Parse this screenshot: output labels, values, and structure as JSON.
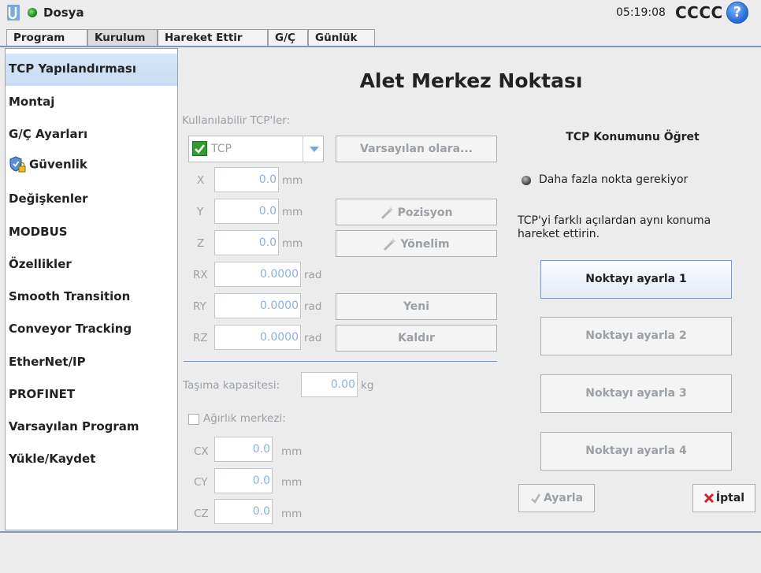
{
  "topbar": {
    "file_label": "Dosya",
    "clock": "05:19:08",
    "robot_name": "CCCC",
    "help_symbol": "?"
  },
  "tabs": [
    {
      "label": "Program",
      "active": false
    },
    {
      "label": "Kurulum",
      "active": true
    },
    {
      "label": "Hareket Ettir",
      "active": false
    },
    {
      "label": "G/Ç",
      "active": false
    },
    {
      "label": "Günlük",
      "active": false
    }
  ],
  "sidebar": {
    "items": [
      {
        "label": "TCP Yapılandırması",
        "active": true
      },
      {
        "label": "Montaj"
      },
      {
        "label": "G/Ç Ayarları"
      },
      {
        "label": "Güvenlik",
        "icon": "shield-lock-icon"
      },
      {
        "label": "Değişkenler"
      },
      {
        "label": "MODBUS"
      },
      {
        "label": "Özellikler"
      },
      {
        "label": "Smooth Transition"
      },
      {
        "label": "Conveyor Tracking"
      },
      {
        "label": "EtherNet/IP"
      },
      {
        "label": "PROFINET"
      },
      {
        "label": "Varsayılan Program"
      },
      {
        "label": "Yükle/Kaydet"
      }
    ]
  },
  "main": {
    "title": "Alet Merkez Noktası",
    "available_label": "Kullanılabilir TCP'ler:",
    "tcp_select": {
      "value": "TCP",
      "checked": true
    },
    "default_button": "Varsayılan olara...",
    "coords": [
      {
        "label": "X",
        "value": "0.0",
        "unit": "mm"
      },
      {
        "label": "Y",
        "value": "0.0",
        "unit": "mm"
      },
      {
        "label": "Z",
        "value": "0.0",
        "unit": "mm"
      },
      {
        "label": "RX",
        "value": "0.0000",
        "unit": "rad"
      },
      {
        "label": "RY",
        "value": "0.0000",
        "unit": "rad"
      },
      {
        "label": "RZ",
        "value": "0.0000",
        "unit": "rad"
      }
    ],
    "position_button": "Pozisyon",
    "orientation_button": "Yönelim",
    "new_button": "Yeni",
    "remove_button": "Kaldır",
    "payload_label": "Taşıma kapasitesi:",
    "payload_value": "0.00",
    "payload_unit": "kg",
    "cog_label": "Ağırlık merkezi:",
    "cog": [
      {
        "label": "CX",
        "value": "0.0",
        "unit": "mm"
      },
      {
        "label": "CY",
        "value": "0.0",
        "unit": "mm"
      },
      {
        "label": "CZ",
        "value": "0.0",
        "unit": "mm"
      }
    ]
  },
  "teach": {
    "title": "TCP Konumunu Öğret",
    "status": "Daha fazla nokta gerekiyor",
    "hint": "TCP'yi farklı açılardan aynı konuma hareket ettirin.",
    "points": [
      "Noktayı ayarla 1",
      "Noktayı ayarla 2",
      "Noktayı ayarla 3",
      "Noktayı ayarla 4"
    ],
    "set_button": "Ayarla",
    "cancel_button": "İptal"
  },
  "colors": {
    "accent": "#7f98b8",
    "active_item": "#c7dcf3",
    "ok_green": "#2e9e2e",
    "cancel_red": "#d62020"
  }
}
